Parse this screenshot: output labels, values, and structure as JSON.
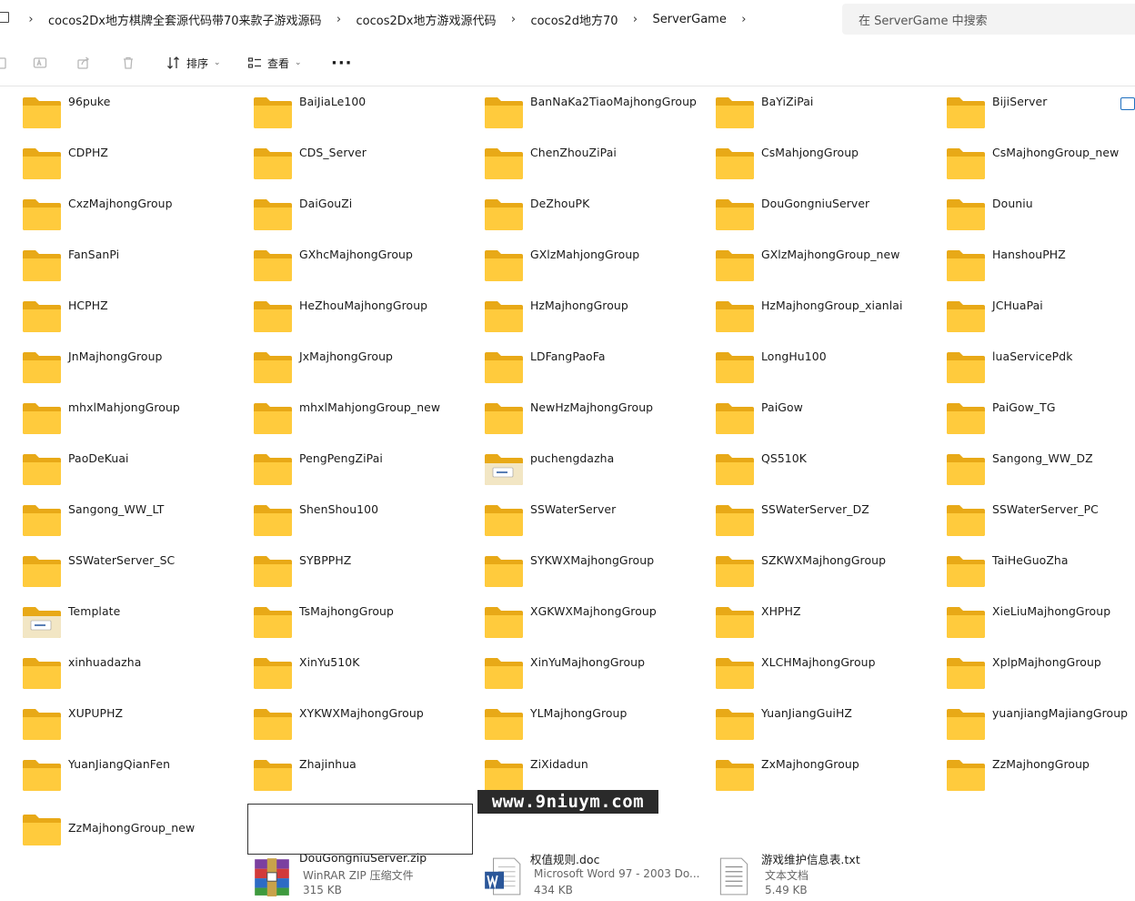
{
  "breadcrumbs": [
    "cocos2Dx地方棋牌全套源代码带70来款子游戏源码",
    "cocos2Dx地方游戏源代码",
    "cocos2d地方70",
    "ServerGame"
  ],
  "search": {
    "placeholder": "在 ServerGame 中搜索"
  },
  "toolbar": {
    "sort_label": "排序",
    "view_label": "查看",
    "more_label": "···"
  },
  "folders": [
    "96puke",
    "BaiJiaLe100",
    "BanNaKa2TiaoMajhongGroup",
    "BaYiZiPai",
    "BijiServer",
    "CDPHZ",
    "CDS_Server",
    "ChenZhouZiPai",
    "CsMahjongGroup",
    "CsMajhongGroup_new",
    "CxzMajhongGroup",
    "DaiGouZi",
    "DeZhouPK",
    "DouGongniuServer",
    "Douniu",
    "FanSanPi",
    "GXhcMajhongGroup",
    "GXlzMahjongGroup",
    "GXlzMajhongGroup_new",
    "HanshouPHZ",
    "HCPHZ",
    "HeZhouMajhongGroup",
    "HzMajhongGroup",
    "HzMajhongGroup_xianlai",
    "JCHuaPai",
    "JnMajhongGroup",
    "JxMajhongGroup",
    "LDFangPaoFa",
    "LongHu100",
    "luaServicePdk",
    "mhxlMahjongGroup",
    "mhxlMahjongGroup_new",
    "NewHzMajhongGroup",
    "PaiGow",
    "PaiGow_TG",
    "PaoDeKuai",
    "PengPengZiPai",
    "puchengdazha",
    "QS510K",
    "Sangong_WW_DZ",
    "Sangong_WW_LT",
    "ShenShou100",
    "SSWaterServer",
    "SSWaterServer_DZ",
    "SSWaterServer_PC",
    "SSWaterServer_SC",
    "SYBPPHZ",
    "SYKWXMajhongGroup",
    "SZKWXMajhongGroup",
    "TaiHeGuoZha",
    "Template",
    "TsMajhongGroup",
    "XGKWXMajhongGroup",
    "XHPHZ",
    "XieLiuMajhongGroup",
    "xinhuadazha",
    "XinYu510K",
    "XinYuMajhongGroup",
    "XLCHMajhongGroup",
    "XplpMajhongGroup",
    "XUPUPHZ",
    "XYKWXMajhongGroup",
    "YLMajhongGroup",
    "YuanJiangGuiHZ",
    "yuanjiangMajiangGroup",
    "YuanJiangQianFen",
    "Zhajinhua",
    "ZiXidadun",
    "ZxMajhongGroup",
    "ZzMajhongGroup",
    "ZzMajhongGroup_new"
  ],
  "special_folders": [
    "puchengdazha",
    "Template"
  ],
  "files": [
    {
      "name": "DouGongniuServer.zip",
      "type": "WinRAR ZIP 压缩文件",
      "size": "315 KB",
      "icon": "winrar-zip-icon"
    },
    {
      "name": "权值规则.doc",
      "type": "Microsoft Word 97 - 2003 Do...",
      "size": "434 KB",
      "icon": "word-doc-icon"
    },
    {
      "name": "游戏维护信息表.txt",
      "type": "文本文档",
      "size": "5.49 KB",
      "icon": "text-file-icon"
    }
  ],
  "watermark": "www.9niuym.com",
  "colors": {
    "folder_back": "#E8A917",
    "folder_front": "#FFCB3D",
    "accent": "#1F6FBF"
  }
}
